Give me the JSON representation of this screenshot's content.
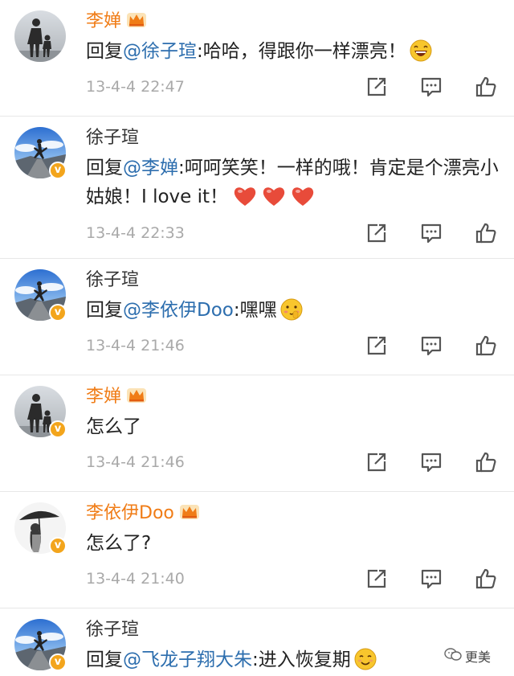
{
  "comments": [
    {
      "username": "李婵",
      "name_color": "#f07c16",
      "has_crown": true,
      "avatar": "mother-child-silhouette",
      "has_v_badge": false,
      "reply_prefix": "回复",
      "mention": "@徐子瑄",
      "text": ":哈哈，得跟你一样漂亮！",
      "trailing_emoji": "laughing-emoji",
      "hearts": 0,
      "timestamp": "13-4-4 22:47"
    },
    {
      "username": "徐子瑄",
      "name_color": "#333333",
      "has_crown": false,
      "avatar": "jumping-person-sky",
      "has_v_badge": true,
      "reply_prefix": "回复",
      "mention": "@李婵",
      "text": ":呵呵笑笑！一样的哦！肯定是个漂亮小姑娘！I love it！",
      "trailing_emoji": "",
      "hearts": 3,
      "timestamp": "13-4-4 22:33"
    },
    {
      "username": "徐子瑄",
      "name_color": "#333333",
      "has_crown": false,
      "avatar": "jumping-person-sky",
      "has_v_badge": true,
      "reply_prefix": "回复",
      "mention": "@李依伊Doo",
      "text": ":嘿嘿",
      "trailing_emoji": "shy-emoji",
      "hearts": 0,
      "timestamp": "13-4-4 21:46"
    },
    {
      "username": "李婵",
      "name_color": "#f07c16",
      "has_crown": true,
      "avatar": "mother-child-silhouette",
      "has_v_badge": true,
      "reply_prefix": "",
      "mention": "",
      "text": "怎么了",
      "trailing_emoji": "",
      "hearts": 0,
      "timestamp": "13-4-4 21:46"
    },
    {
      "username": "李依伊Doo",
      "name_color": "#f07c16",
      "has_crown": true,
      "avatar": "girl-with-umbrella",
      "has_v_badge": true,
      "reply_prefix": "",
      "mention": "",
      "text": "怎么了?",
      "trailing_emoji": "",
      "hearts": 0,
      "timestamp": "13-4-4 21:40"
    },
    {
      "username": "徐子瑄",
      "name_color": "#333333",
      "has_crown": false,
      "avatar": "jumping-person-sky",
      "has_v_badge": true,
      "reply_prefix": "回复",
      "mention": "@飞龙子翔大朱",
      "text": ":进入恢复期",
      "trailing_emoji": "smile-emoji",
      "hearts": 0,
      "timestamp": ""
    }
  ],
  "actions": [
    "share-icon",
    "comment-icon",
    "like-icon"
  ],
  "watermark": {
    "icon": "wechat-logo-icon",
    "text": "更美"
  },
  "colors": {
    "vip_name": "#f07c16",
    "mention": "#2d6eae",
    "timestamp": "#a9a9a9",
    "v_badge": "#f3a51c",
    "divider": "#e7e7e7",
    "heart": "#e84b3a"
  }
}
